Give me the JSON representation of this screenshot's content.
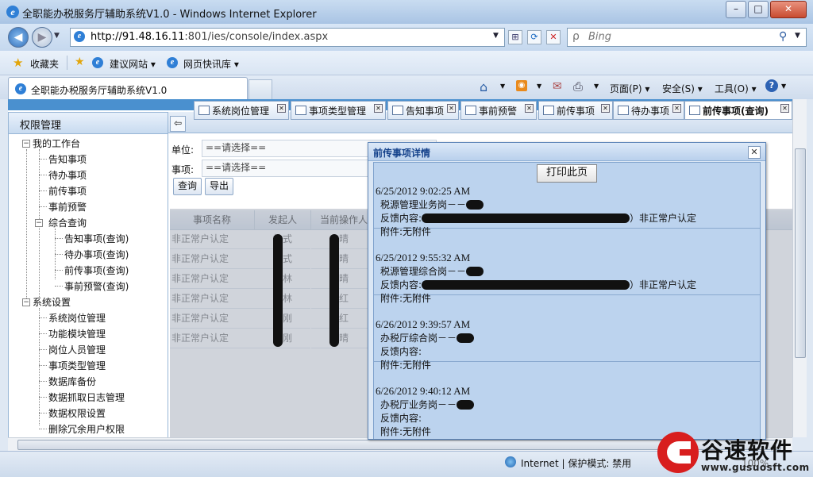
{
  "browser": {
    "window_title": "全职能办税服务厅辅助系统V1.0 - Windows Internet Explorer",
    "url_host": "http://91.48.16.11",
    "url_path": ":801/ies/console/index.aspx",
    "search_placeholder": "Bing",
    "tab_title": "全职能办税服务厅辅助系统V1.0",
    "favorites": {
      "label": "收藏夹",
      "suggested_sites": "建议网站",
      "web_slices": "网页快讯库"
    },
    "commands": {
      "page": "页面(P)",
      "safety": "安全(S)",
      "tools": "工具(O)",
      "help": "?"
    }
  },
  "sidebar": {
    "title": "权限管理",
    "groups": [
      {
        "label": "我的工作台",
        "items": [
          "告知事项",
          "待办事项",
          "前传事项",
          "事前预警"
        ],
        "subgroup": {
          "label": "综合查询",
          "items": [
            "告知事项(查询)",
            "待办事项(查询)",
            "前传事项(查询)",
            "事前预警(查询)"
          ]
        }
      },
      {
        "label": "系统设置",
        "items": [
          "系统岗位管理",
          "功能模块管理",
          "岗位人员管理",
          "事项类型管理",
          "数据库备份",
          "数据抓取日志管理",
          "数据权限设置",
          "删除冗余用户权限"
        ]
      }
    ]
  },
  "tabs": [
    "系统岗位管理",
    "事项类型管理",
    "告知事项",
    "事前预警",
    "前传事项",
    "待办事项",
    "前传事项(查询)"
  ],
  "filters": {
    "unit_label": "单位:",
    "unit_value": "==请选择==",
    "item_label": "事项:",
    "item_value": "==请选择==",
    "query_button": "查询",
    "export_button": "导出"
  },
  "grid": {
    "columns": [
      "事项名称",
      "发起人",
      "当前操作人"
    ],
    "rows": [
      [
        "非正常户认定",
        "柏式",
        "晴"
      ],
      [
        "非正常户认定",
        "柏式",
        "晴"
      ],
      [
        "非正常户认定",
        "蒲林",
        "晴"
      ],
      [
        "非正常户认定",
        "蒲林",
        "红"
      ],
      [
        "非正常户认定",
        "赵刚",
        "红"
      ],
      [
        "非正常户认定",
        "赵刚",
        "晴"
      ]
    ]
  },
  "dialog": {
    "title": "前传事项详情",
    "print_button": "打印此页",
    "entries": [
      {
        "timestamp": "6/25/2012 9:02:25 AM",
        "role": "税源管理业务岗－－",
        "feedback_label": "反馈内容:",
        "feedback_suffix": "）非正常户认定",
        "attachment": "附件:无附件"
      },
      {
        "timestamp": "6/25/2012 9:55:32 AM",
        "role": "税源管理综合岗－－",
        "feedback_label": "反馈内容:",
        "feedback_suffix": "）非正常户认定",
        "attachment": "附件:无附件"
      },
      {
        "timestamp": "6/26/2012 9:39:57 AM",
        "role": "办税厅综合岗－－",
        "feedback_label": "反馈内容:",
        "feedback_suffix": "",
        "attachment": "附件:无附件"
      },
      {
        "timestamp": "6/26/2012 9:40:12 AM",
        "role": "办税厅业务岗－－",
        "feedback_label": "反馈内容:",
        "feedback_suffix": "",
        "attachment": "附件:无附件"
      }
    ]
  },
  "status": {
    "zone": "Internet | 保护模式: 禁用",
    "zoom": "100%"
  },
  "watermark": {
    "brand": "谷速软件",
    "url": "www.gusuosft.com"
  },
  "colors": {
    "accent": "#4a90cf",
    "brand_red": "#d81e1e"
  }
}
